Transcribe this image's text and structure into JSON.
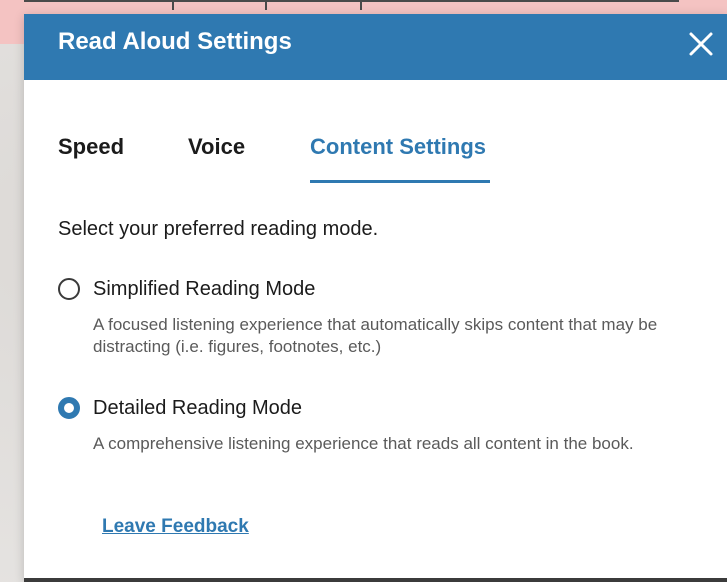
{
  "dialog": {
    "title": "Read Aloud Settings",
    "close_icon": "close-icon"
  },
  "tabs": [
    {
      "label": "Speed",
      "active": false
    },
    {
      "label": "Voice",
      "active": false
    },
    {
      "label": "Content Settings",
      "active": true
    }
  ],
  "content": {
    "prompt": "Select your preferred reading mode.",
    "options": [
      {
        "label": "Simplified Reading Mode",
        "description": "A focused listening experience that automatically skips content that may be distracting (i.e. figures, footnotes, etc.)",
        "selected": false
      },
      {
        "label": "Detailed Reading Mode",
        "description": "A comprehensive listening experience that reads all content in the book.",
        "selected": true
      }
    ],
    "feedback_link": "Leave Feedback"
  },
  "colors": {
    "header_bg": "#2f79b1",
    "accent": "#2f79b1",
    "top_strip": "#f4c3c2"
  }
}
